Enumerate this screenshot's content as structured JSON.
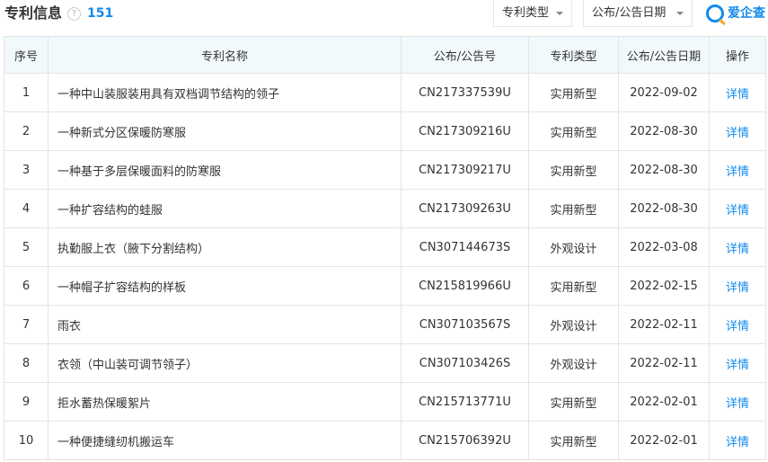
{
  "header": {
    "title": "专利信息",
    "help_glyph": "?",
    "count": "151",
    "filter_type_label": "专利类型",
    "filter_date_label": "公布/公告日期",
    "logo_text": "爱企查"
  },
  "table": {
    "columns": [
      "序号",
      "专利名称",
      "公布/公告号",
      "专利类型",
      "公布/公告日期",
      "操作"
    ],
    "rows": [
      {
        "no": "1",
        "name": "一种中山装服装用具有双档调节结构的领子",
        "pub": "CN217337539U",
        "type": "实用新型",
        "date": "2022-09-02",
        "op": "详情"
      },
      {
        "no": "2",
        "name": "一种新式分区保暖防寒服",
        "pub": "CN217309216U",
        "type": "实用新型",
        "date": "2022-08-30",
        "op": "详情"
      },
      {
        "no": "3",
        "name": "一种基于多层保暖面料的防寒服",
        "pub": "CN217309217U",
        "type": "实用新型",
        "date": "2022-08-30",
        "op": "详情"
      },
      {
        "no": "4",
        "name": "一种扩容结构的蛙服",
        "pub": "CN217309263U",
        "type": "实用新型",
        "date": "2022-08-30",
        "op": "详情"
      },
      {
        "no": "5",
        "name": "执勤服上衣（腋下分割结构）",
        "pub": "CN307144673S",
        "type": "外观设计",
        "date": "2022-03-08",
        "op": "详情"
      },
      {
        "no": "6",
        "name": "一种帽子扩容结构的样板",
        "pub": "CN215819966U",
        "type": "实用新型",
        "date": "2022-02-15",
        "op": "详情"
      },
      {
        "no": "7",
        "name": "雨衣",
        "pub": "CN307103567S",
        "type": "外观设计",
        "date": "2022-02-11",
        "op": "详情"
      },
      {
        "no": "8",
        "name": "衣领（中山装可调节领子）",
        "pub": "CN307103426S",
        "type": "外观设计",
        "date": "2022-02-11",
        "op": "详情"
      },
      {
        "no": "9",
        "name": "拒水蓄热保暖絮片",
        "pub": "CN215713771U",
        "type": "实用新型",
        "date": "2022-02-01",
        "op": "详情"
      },
      {
        "no": "10",
        "name": "一种便捷缝纫机搬运车",
        "pub": "CN215706392U",
        "type": "实用新型",
        "date": "2022-02-01",
        "op": "详情"
      }
    ]
  },
  "colors": {
    "accent": "#128bed",
    "header_bg": "#f2f9fc",
    "border": "#e4e4e4"
  }
}
